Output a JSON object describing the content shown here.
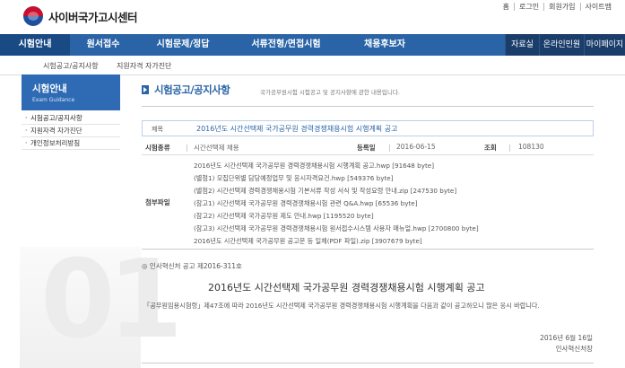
{
  "header": {
    "logo_text": "사이버국가고시센터",
    "utility_links": [
      "홈",
      "로그인",
      "회원가입",
      "사이트맵"
    ]
  },
  "nav": {
    "items": [
      "시험안내",
      "원서접수",
      "시험문제/정답",
      "서류전형/면접시험",
      "채용후보자"
    ],
    "right_items": [
      "자료실",
      "온라인민원",
      "마이페이지"
    ]
  },
  "subnav": {
    "items": [
      "시험공고/공지사항",
      "지원자격 자가진단"
    ]
  },
  "lnb": {
    "title": "시험안내",
    "subtitle": "Exam Guidance",
    "items": [
      "시험공고/공지사항",
      "지원자격 자가진단",
      "개인정보처리방침"
    ]
  },
  "page": {
    "title": "시험공고/공지사항",
    "description": "국가공무원시험 시험공고 및 공지사항에 관한 내용입니다."
  },
  "post": {
    "subject_label": "제목",
    "subject": "2016년도 시간선택제 국가공무원 경력경쟁채용시험 시행계획 공고",
    "type_label": "시험종류",
    "type_value": "시간선택제 채용",
    "date_label": "등록일",
    "date_value": "2016-06-15",
    "views_label": "조회",
    "views_value": "108130",
    "files_label": "첨부파일",
    "files": [
      "2016년도 시간선택제 국가공무원 경력경쟁채용시험 시행계획 공고.hwp [91648 byte]",
      "(별첨1) 모집단위별 담당예정업무 및 응시자격요건.hwp [549376 byte]",
      "(별첨2) 시간선택제 경력경쟁채용시험 기본서류 작성 서식 및 작성요령 안내.zip [247530 byte]",
      "(참고1) 시간선택제 국가공무원 경력경쟁채용시험 관련 Q&A.hwp [65536 byte]",
      "(참고2) 시간선택제 국가공무원 제도 안내.hwp [1195520 byte]",
      "(참고3) 시간선택제 국가공무원 경력경쟁채용시험 원서접수시스템 사용자 매뉴얼.hwp [2700800 byte]",
      "2016년도 시간선택제 국가공무원 공고문 등 일체(PDF 파일).zip [3907679 byte]"
    ],
    "notice_number": "◎ 인사혁신처 공고 제2016-311호",
    "doc_title": "2016년도 시간선택제 국가공무원 경력경쟁채용시험 시행계획 공고",
    "body": "「공무원임용시험령」제47조에 따라 2016년도 시간선택제 국가공무원 경력경쟁채용시험 시행계획을 다음과 같이 공고하오니 많은 응시 바랍니다.",
    "doc_date": "2016년 6월 16일",
    "signer": "인사혁신처장"
  },
  "watermark": "01"
}
